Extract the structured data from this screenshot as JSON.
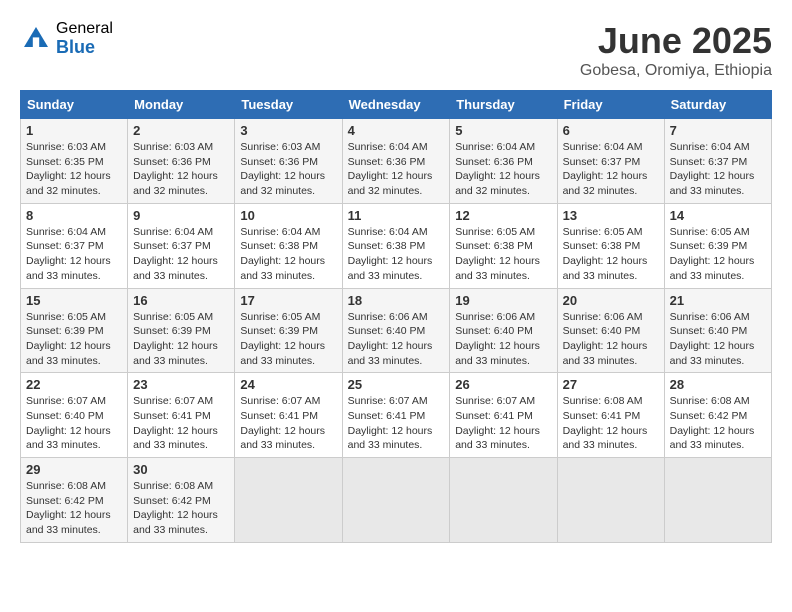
{
  "logo": {
    "general": "General",
    "blue": "Blue"
  },
  "header": {
    "month": "June 2025",
    "location": "Gobesa, Oromiya, Ethiopia"
  },
  "days_of_week": [
    "Sunday",
    "Monday",
    "Tuesday",
    "Wednesday",
    "Thursday",
    "Friday",
    "Saturday"
  ],
  "weeks": [
    [
      {
        "day": "1",
        "sunrise": "6:03 AM",
        "sunset": "6:35 PM",
        "daylight": "12 hours and 32 minutes."
      },
      {
        "day": "2",
        "sunrise": "6:03 AM",
        "sunset": "6:36 PM",
        "daylight": "12 hours and 32 minutes."
      },
      {
        "day": "3",
        "sunrise": "6:03 AM",
        "sunset": "6:36 PM",
        "daylight": "12 hours and 32 minutes."
      },
      {
        "day": "4",
        "sunrise": "6:04 AM",
        "sunset": "6:36 PM",
        "daylight": "12 hours and 32 minutes."
      },
      {
        "day": "5",
        "sunrise": "6:04 AM",
        "sunset": "6:36 PM",
        "daylight": "12 hours and 32 minutes."
      },
      {
        "day": "6",
        "sunrise": "6:04 AM",
        "sunset": "6:37 PM",
        "daylight": "12 hours and 32 minutes."
      },
      {
        "day": "7",
        "sunrise": "6:04 AM",
        "sunset": "6:37 PM",
        "daylight": "12 hours and 33 minutes."
      }
    ],
    [
      {
        "day": "8",
        "sunrise": "6:04 AM",
        "sunset": "6:37 PM",
        "daylight": "12 hours and 33 minutes."
      },
      {
        "day": "9",
        "sunrise": "6:04 AM",
        "sunset": "6:37 PM",
        "daylight": "12 hours and 33 minutes."
      },
      {
        "day": "10",
        "sunrise": "6:04 AM",
        "sunset": "6:38 PM",
        "daylight": "12 hours and 33 minutes."
      },
      {
        "day": "11",
        "sunrise": "6:04 AM",
        "sunset": "6:38 PM",
        "daylight": "12 hours and 33 minutes."
      },
      {
        "day": "12",
        "sunrise": "6:05 AM",
        "sunset": "6:38 PM",
        "daylight": "12 hours and 33 minutes."
      },
      {
        "day": "13",
        "sunrise": "6:05 AM",
        "sunset": "6:38 PM",
        "daylight": "12 hours and 33 minutes."
      },
      {
        "day": "14",
        "sunrise": "6:05 AM",
        "sunset": "6:39 PM",
        "daylight": "12 hours and 33 minutes."
      }
    ],
    [
      {
        "day": "15",
        "sunrise": "6:05 AM",
        "sunset": "6:39 PM",
        "daylight": "12 hours and 33 minutes."
      },
      {
        "day": "16",
        "sunrise": "6:05 AM",
        "sunset": "6:39 PM",
        "daylight": "12 hours and 33 minutes."
      },
      {
        "day": "17",
        "sunrise": "6:05 AM",
        "sunset": "6:39 PM",
        "daylight": "12 hours and 33 minutes."
      },
      {
        "day": "18",
        "sunrise": "6:06 AM",
        "sunset": "6:40 PM",
        "daylight": "12 hours and 33 minutes."
      },
      {
        "day": "19",
        "sunrise": "6:06 AM",
        "sunset": "6:40 PM",
        "daylight": "12 hours and 33 minutes."
      },
      {
        "day": "20",
        "sunrise": "6:06 AM",
        "sunset": "6:40 PM",
        "daylight": "12 hours and 33 minutes."
      },
      {
        "day": "21",
        "sunrise": "6:06 AM",
        "sunset": "6:40 PM",
        "daylight": "12 hours and 33 minutes."
      }
    ],
    [
      {
        "day": "22",
        "sunrise": "6:07 AM",
        "sunset": "6:40 PM",
        "daylight": "12 hours and 33 minutes."
      },
      {
        "day": "23",
        "sunrise": "6:07 AM",
        "sunset": "6:41 PM",
        "daylight": "12 hours and 33 minutes."
      },
      {
        "day": "24",
        "sunrise": "6:07 AM",
        "sunset": "6:41 PM",
        "daylight": "12 hours and 33 minutes."
      },
      {
        "day": "25",
        "sunrise": "6:07 AM",
        "sunset": "6:41 PM",
        "daylight": "12 hours and 33 minutes."
      },
      {
        "day": "26",
        "sunrise": "6:07 AM",
        "sunset": "6:41 PM",
        "daylight": "12 hours and 33 minutes."
      },
      {
        "day": "27",
        "sunrise": "6:08 AM",
        "sunset": "6:41 PM",
        "daylight": "12 hours and 33 minutes."
      },
      {
        "day": "28",
        "sunrise": "6:08 AM",
        "sunset": "6:42 PM",
        "daylight": "12 hours and 33 minutes."
      }
    ],
    [
      {
        "day": "29",
        "sunrise": "6:08 AM",
        "sunset": "6:42 PM",
        "daylight": "12 hours and 33 minutes."
      },
      {
        "day": "30",
        "sunrise": "6:08 AM",
        "sunset": "6:42 PM",
        "daylight": "12 hours and 33 minutes."
      },
      null,
      null,
      null,
      null,
      null
    ]
  ],
  "labels": {
    "sunrise": "Sunrise:",
    "sunset": "Sunset:",
    "daylight": "Daylight:"
  }
}
